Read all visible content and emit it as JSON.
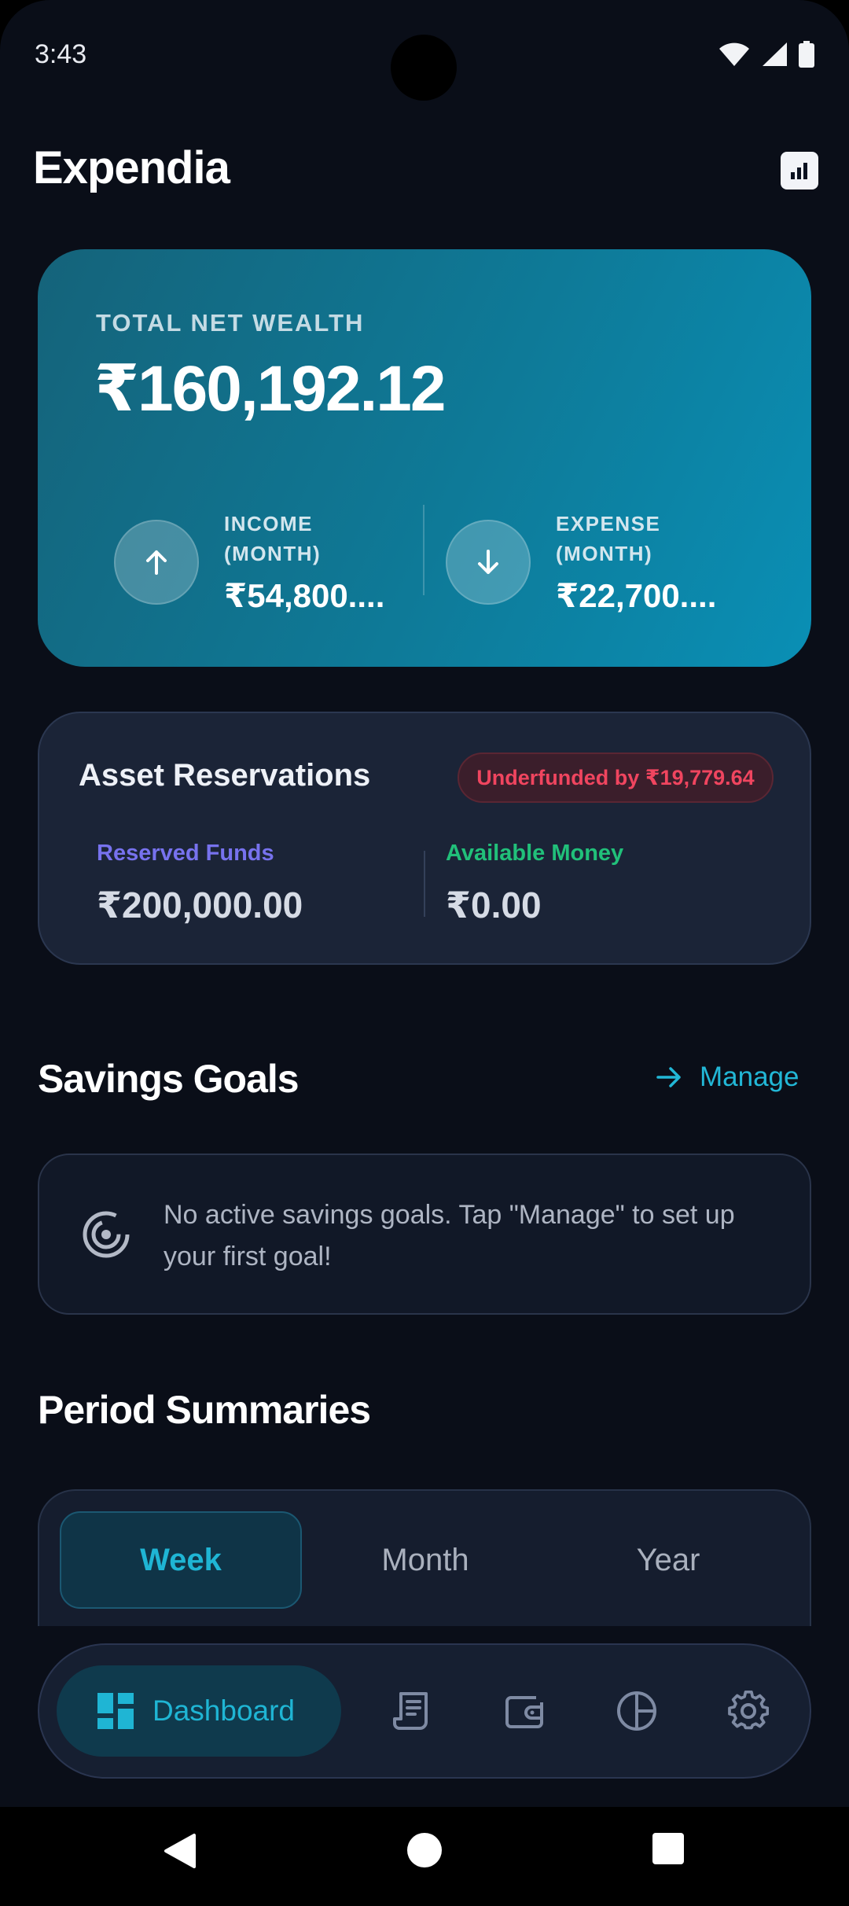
{
  "status_bar": {
    "time": "3:43"
  },
  "header": {
    "title": "Expendia",
    "action_icon": "bar-chart-icon"
  },
  "wealth": {
    "label": "TOTAL NET WEALTH",
    "value": "₹160,192.12",
    "income": {
      "label": "INCOME (MONTH)",
      "amount": "₹54,800...."
    },
    "expense": {
      "label": "EXPENSE (MONTH)",
      "amount": "₹22,700...."
    }
  },
  "assets": {
    "title": "Asset Reservations",
    "badge": "Underfunded by ₹19,779.64",
    "reserved_label": "Reserved Funds",
    "reserved_value": "₹200,000.00",
    "available_label": "Available Money",
    "available_value": "₹0.00"
  },
  "savings": {
    "title": "Savings Goals",
    "manage_label": "Manage",
    "empty_message": "No active savings goals. Tap \"Manage\" to set up your first goal!"
  },
  "period": {
    "title": "Period Summaries",
    "tabs": [
      "Week",
      "Month",
      "Year"
    ],
    "selected": "Week"
  },
  "nav": {
    "active_label": "Dashboard",
    "items": [
      "dashboard-icon",
      "receipt-icon",
      "wallet-icon",
      "pie-chart-icon",
      "settings-icon"
    ]
  },
  "colors": {
    "accent": "#1fb5d4",
    "reserved": "#7772ee",
    "available": "#21c07a",
    "danger": "#f0455f",
    "background": "#0a0e18"
  }
}
